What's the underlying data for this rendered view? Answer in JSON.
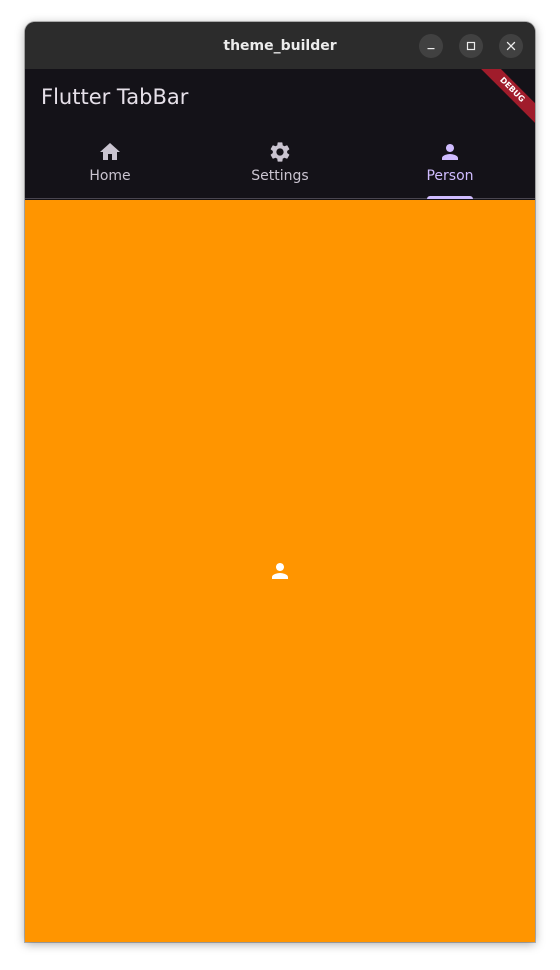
{
  "window": {
    "title": "theme_builder"
  },
  "appbar": {
    "title": "Flutter TabBar",
    "debug_label": "DEBUG"
  },
  "tabs": [
    {
      "label": "Home",
      "icon": "home-icon",
      "selected": false
    },
    {
      "label": "Settings",
      "icon": "gear-icon",
      "selected": false
    },
    {
      "label": "Person",
      "icon": "person-icon",
      "selected": true
    }
  ],
  "content": {
    "icon": "person-icon",
    "background_color": "#ff9500"
  },
  "colors": {
    "surface": "#141218",
    "titlebar": "#2c2c2c",
    "tab_label": "#cac4d0",
    "tab_selected": "#d0bcff",
    "debug_banner": "#a01c2b",
    "content_background": "#ff9500"
  }
}
